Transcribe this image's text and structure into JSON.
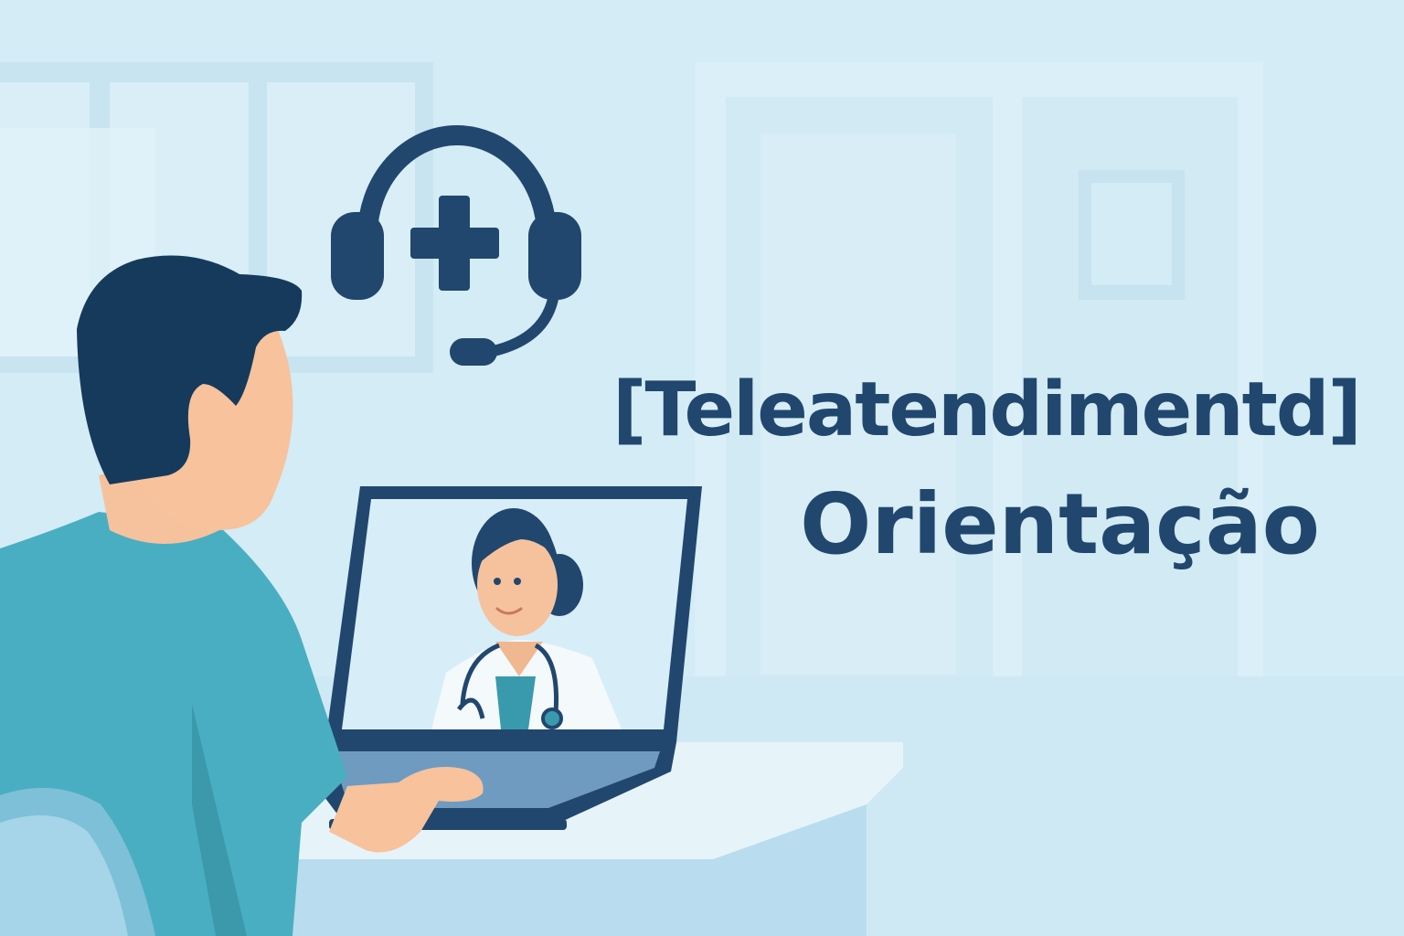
{
  "headline": {
    "line1": "[Teleatendimentd]",
    "line2": "Orientação"
  },
  "icons": {
    "headset": "headset-medical-cross-icon",
    "laptop": "laptop-icon",
    "doctor": "doctor-avatar",
    "patient": "patient-figure"
  },
  "colors": {
    "background": "#d3ecf6",
    "navy": "#21476f",
    "teal_shirt": "#4aaec2",
    "skin": "#f7c29c",
    "desk": "#e6f4fa"
  }
}
